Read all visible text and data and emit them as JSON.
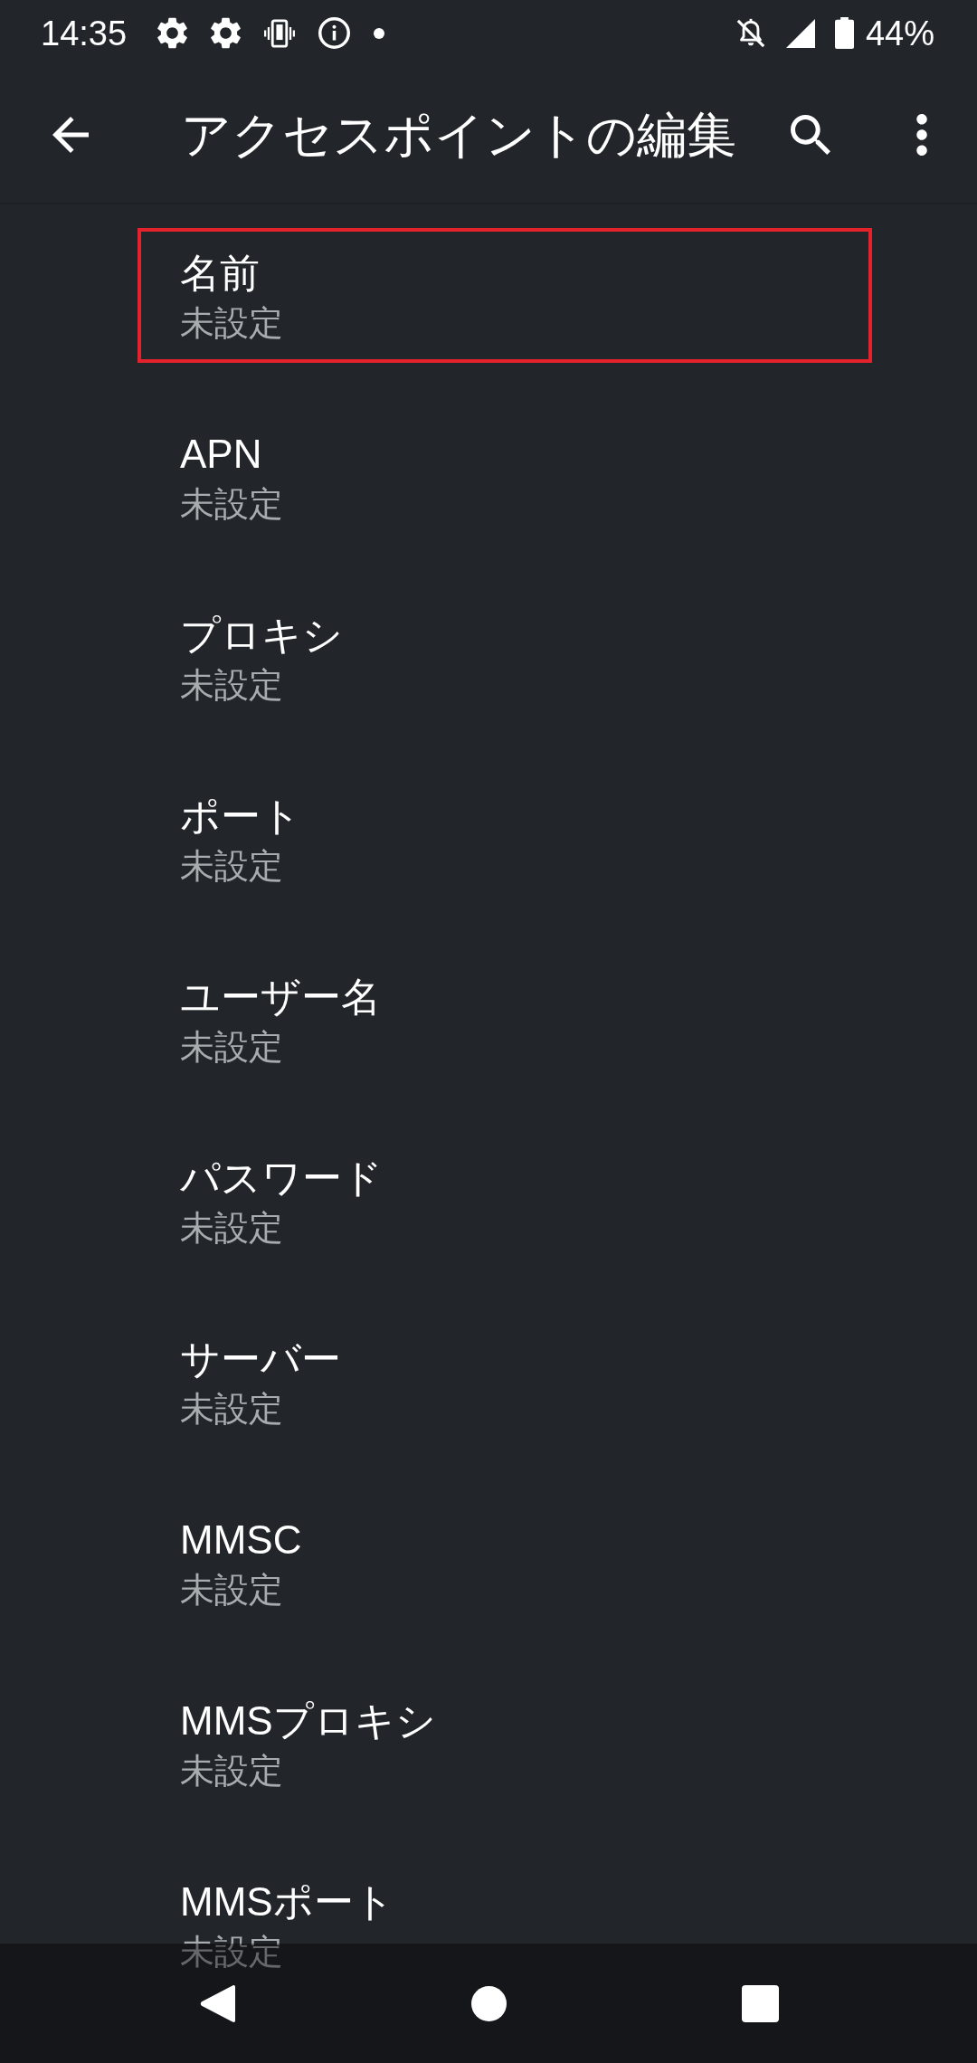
{
  "status_bar": {
    "time": "14:35",
    "battery_percent": "44%"
  },
  "app_bar": {
    "title": "アクセスポイントの編集"
  },
  "settings": [
    {
      "title": "名前",
      "value": "未設定",
      "highlighted": true
    },
    {
      "title": "APN",
      "value": "未設定",
      "highlighted": false
    },
    {
      "title": "プロキシ",
      "value": "未設定",
      "highlighted": false
    },
    {
      "title": "ポート",
      "value": "未設定",
      "highlighted": false
    },
    {
      "title": "ユーザー名",
      "value": "未設定",
      "highlighted": false
    },
    {
      "title": "パスワード",
      "value": "未設定",
      "highlighted": false
    },
    {
      "title": "サーバー",
      "value": "未設定",
      "highlighted": false
    },
    {
      "title": "MMSC",
      "value": "未設定",
      "highlighted": false
    },
    {
      "title": "MMSプロキシ",
      "value": "未設定",
      "highlighted": false
    },
    {
      "title": "MMSポート",
      "value": "未設定",
      "highlighted": false
    }
  ]
}
